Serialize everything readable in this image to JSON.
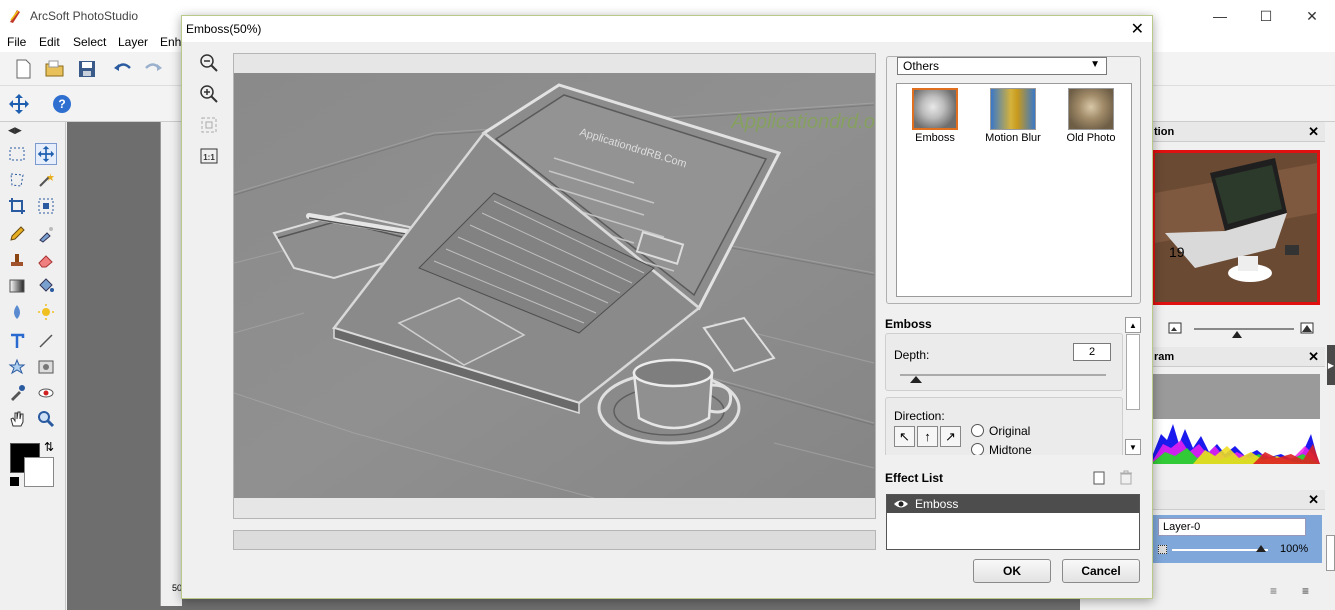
{
  "app": {
    "title": "ArcSoft PhotoStudio",
    "menus": [
      "File",
      "Edit",
      "Select",
      "Layer",
      "Enh"
    ],
    "doc_zoom": "50"
  },
  "dock": {
    "navigator_title": "tion",
    "navigator_image_text": "19",
    "histogram_title": "ram",
    "layer_name": "Layer-0",
    "layer_opacity": "100%"
  },
  "dialog": {
    "title": "Emboss(50%)",
    "category": {
      "selected": "Others",
      "effects": [
        {
          "label": "Emboss",
          "selected": true
        },
        {
          "label": "Motion Blur",
          "selected": false
        },
        {
          "label": "Old Photo",
          "selected": false
        }
      ]
    },
    "watermark_text": "Applicationdrd.org",
    "screen_text": "ApplicationdrdRB.Com",
    "settings": {
      "title": "Emboss",
      "depth_label": "Depth:",
      "depth_value": "2",
      "depth_slider_value": 0.08,
      "direction_label": "Direction:",
      "radio_options": [
        "Original",
        "Midtone"
      ]
    },
    "effect_list": {
      "title": "Effect List",
      "items": [
        "Emboss"
      ]
    },
    "buttons": {
      "ok": "OK",
      "cancel": "Cancel"
    }
  },
  "colors": {
    "accent_selection": "#e07020",
    "layer_highlight": "#7fa7da",
    "navigator_border": "#e01010",
    "effect_row_bg": "#4d4d4d"
  }
}
